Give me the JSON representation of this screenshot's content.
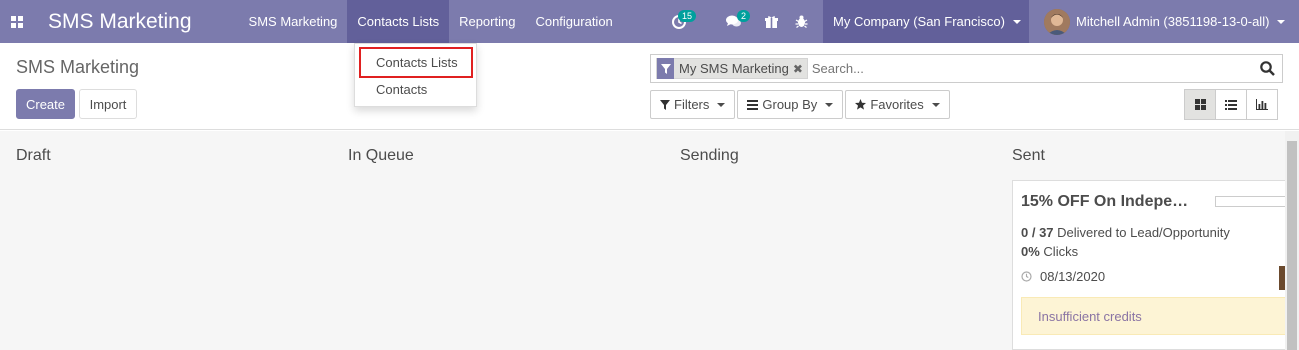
{
  "navbar": {
    "brand": "SMS Marketing",
    "menu": [
      {
        "label": "SMS Marketing"
      },
      {
        "label": "Contacts Lists"
      },
      {
        "label": "Reporting"
      },
      {
        "label": "Configuration"
      }
    ],
    "activities_count": "15",
    "messages_count": "2",
    "company": "My Company (San Francisco)",
    "user": "Mitchell Admin (3851198-13-0-all)"
  },
  "dropdown": {
    "items": [
      {
        "label": "Contacts Lists"
      },
      {
        "label": "Contacts"
      }
    ]
  },
  "control_panel": {
    "breadcrumb": "SMS Marketing",
    "create_label": "Create",
    "import_label": "Import",
    "search": {
      "facet": "My SMS Marketing",
      "placeholder": "Search..."
    },
    "filters_label": "Filters",
    "groupby_label": "Group By",
    "favorites_label": "Favorites"
  },
  "kanban": {
    "columns": [
      {
        "title": "Draft"
      },
      {
        "title": "In Queue"
      },
      {
        "title": "Sending"
      },
      {
        "title": "Sent"
      }
    ],
    "card": {
      "title": "15% OFF On Indepe…",
      "delivered_count": "0 / 37",
      "delivered_text": "Delivered to Lead/Opportunity",
      "clicks_value": "0%",
      "clicks_text": "Clicks",
      "date": "08/13/2020",
      "alert": "Insufficient credits"
    }
  },
  "colors": {
    "navbar": "#7c7bad",
    "navbar_active": "#62609a",
    "badge": "#00a09d",
    "highlight_border": "#e02020",
    "alert_bg": "#fdf4d5"
  }
}
